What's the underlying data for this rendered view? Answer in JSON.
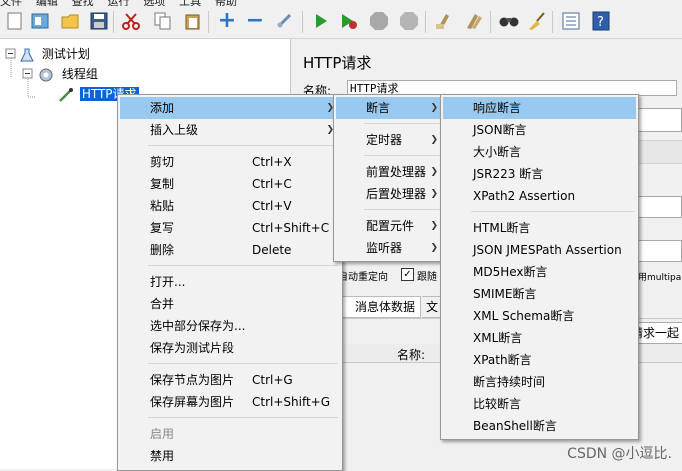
{
  "menubar": [
    "文件",
    "编辑",
    "查找",
    "运行",
    "选项",
    "工具",
    "帮助"
  ],
  "toolbar": [
    "new-icon",
    "templates-icon",
    "open-icon",
    "save-icon",
    "cut-icon",
    "copy-icon",
    "paste-icon",
    "expand-icon",
    "collapse-icon",
    "toggle-icon",
    "start-icon",
    "start-no-pause-icon",
    "stop-icon",
    "shutdown-icon",
    "clear-icon",
    "clear-all-icon",
    "search-icon",
    "reset-search-icon",
    "function-helper-icon",
    "help-icon"
  ],
  "tree": {
    "test_plan": "测试计划",
    "thread_group": "线程组",
    "http_request": "HTTP请求"
  },
  "right": {
    "title": "HTTP请求",
    "name_label": "名称:",
    "name_value": "HTTP请求",
    "auto_redirect": "自动重定向",
    "follow_redirect": "跟随",
    "multipart_partial": "用multipa",
    "tab_body": "消息体数据",
    "tab_files": "文",
    "send_together": "请求一起",
    "param_name_col": "名称:"
  },
  "context_menu": {
    "add": "添加",
    "insert_parent": "插入上级",
    "cut": "剪切",
    "cut_sc": "Ctrl+X",
    "copy": "复制",
    "copy_sc": "Ctrl+C",
    "paste": "粘贴",
    "paste_sc": "Ctrl+V",
    "duplicate": "复写",
    "duplicate_sc": "Ctrl+Shift+C",
    "delete": "删除",
    "delete_sc": "Delete",
    "open": "打开...",
    "merge": "合并",
    "save_selection": "选中部分保存为...",
    "save_as_fragment": "保存为测试片段",
    "save_node_image": "保存节点为图片",
    "save_node_image_sc": "Ctrl+G",
    "save_screen_image": "保存屏幕为图片",
    "save_screen_image_sc": "Ctrl+Shift+G",
    "enable": "启用",
    "disable": "禁用"
  },
  "add_submenu": {
    "assertions": "断言",
    "timer": "定时器",
    "pre_processors": "前置处理器",
    "post_processors": "后置处理器",
    "config_element": "配置元件",
    "listener": "监听器"
  },
  "assertions_submenu": [
    "响应断言",
    "JSON断言",
    "大小断言",
    "JSR223 断言",
    "XPath2 Assertion",
    "HTML断言",
    "JSON JMESPath Assertion",
    "MD5Hex断言",
    "SMIME断言",
    "XML Schema断言",
    "XML断言",
    "XPath断言",
    "断言持续时间",
    "比较断言",
    "BeanShell断言"
  ],
  "watermark": "CSDN @小逗比.",
  "colors": {
    "highlight": "#99c9ef",
    "selection": "#0a64d8",
    "menu_bg": "#f2f2f2"
  }
}
